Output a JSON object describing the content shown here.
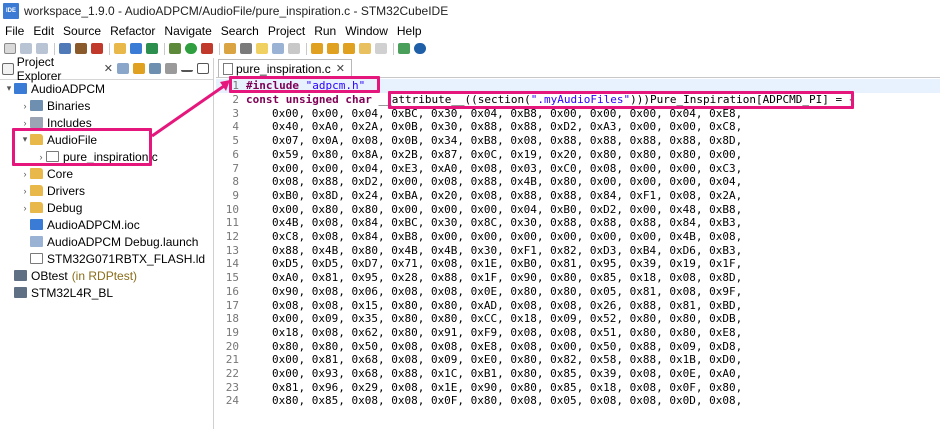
{
  "window": {
    "icon_label": "IDE",
    "title": "workspace_1.9.0 - AudioADPCM/AudioFile/pure_inspiration.c - STM32CubeIDE"
  },
  "menu": [
    "File",
    "Edit",
    "Source",
    "Refactor",
    "Navigate",
    "Search",
    "Project",
    "Run",
    "Window",
    "Help"
  ],
  "explorer": {
    "tab_label": "Project Explorer",
    "close": "✕",
    "tree": [
      {
        "label": "AudioADPCM",
        "twisty": "▾",
        "icon": "project-icon",
        "depth": 0
      },
      {
        "label": "Binaries",
        "twisty": "›",
        "icon": "binaries-icon",
        "depth": 1
      },
      {
        "label": "Includes",
        "twisty": "›",
        "icon": "includes-icon",
        "depth": 1
      },
      {
        "label": "AudioFile",
        "twisty": "▾",
        "icon": "folder-icon",
        "depth": 1
      },
      {
        "label": "pure_inspiration.c",
        "twisty": "›",
        "icon": "c-file-icon",
        "depth": 2
      },
      {
        "label": "Core",
        "twisty": "›",
        "icon": "folder-icon",
        "depth": 1
      },
      {
        "label": "Drivers",
        "twisty": "›",
        "icon": "folder-icon",
        "depth": 1
      },
      {
        "label": "Debug",
        "twisty": "›",
        "icon": "folder-icon",
        "depth": 1
      },
      {
        "label": "AudioADPCM.ioc",
        "twisty": "",
        "icon": "ioc-file-icon",
        "depth": 1
      },
      {
        "label": "AudioADPCM Debug.launch",
        "twisty": "",
        "icon": "launch-file-icon",
        "depth": 1
      },
      {
        "label": "STM32G071RBTX_FLASH.ld",
        "twisty": "",
        "icon": "ld-file-icon",
        "depth": 1
      },
      {
        "label": "OBtest",
        "sub": "(in RDPtest)",
        "twisty": "",
        "icon": "project-icon",
        "depth": 0
      },
      {
        "label": "STM32L4R_BL",
        "twisty": "",
        "icon": "project-icon",
        "depth": 0
      }
    ]
  },
  "editor": {
    "tab_label": "pure_inspiration.c",
    "close": "✕",
    "line1": {
      "kw": "#include",
      "str": "\"adpcm.h\""
    },
    "line2": {
      "kw": "const unsigned char",
      "attr": " __attribute__((section(",
      "section": "\".myAudioFiles\"",
      "rest": ")))Pure_Inspiration[ADPCMD_PI] = {"
    },
    "data_lines": [
      {
        "n": "3",
        "text": "0x00, 0x00, 0x04, 0xBC, 0x30, 0x04, 0xB8, 0x00, 0x00, 0x00, 0x04, 0xE8,"
      },
      {
        "n": "4",
        "text": "0x40, 0xA0, 0x2A, 0x0B, 0x30, 0x88, 0x88, 0xD2, 0xA3, 0x00, 0x00, 0xC8,"
      },
      {
        "n": "5",
        "text": "0x07, 0x0A, 0x08, 0x0B, 0x34, 0xB8, 0x08, 0x88, 0x88, 0x88, 0x88, 0x8D,"
      },
      {
        "n": "6",
        "text": "0x59, 0x80, 0x8A, 0x2B, 0x87, 0x0C, 0x19, 0x20, 0x80, 0x80, 0x80, 0x00,"
      },
      {
        "n": "7",
        "text": "0x00, 0x00, 0x04, 0xE3, 0xA0, 0x08, 0x03, 0xC0, 0x08, 0x00, 0x00, 0xC3,"
      },
      {
        "n": "8",
        "text": "0x08, 0x88, 0xD2, 0x00, 0x08, 0x88, 0x4B, 0x80, 0x00, 0x00, 0x00, 0x04,"
      },
      {
        "n": "9",
        "text": "0xB0, 0x8D, 0x24, 0xBA, 0x20, 0x08, 0x88, 0x88, 0x84, 0xF1, 0x08, 0x2A,"
      },
      {
        "n": "10",
        "text": "0x00, 0x80, 0x80, 0x00, 0x00, 0x00, 0x04, 0xB0, 0xD2, 0x00, 0x48, 0xB8,"
      },
      {
        "n": "11",
        "text": "0x4B, 0x08, 0x84, 0xBC, 0x30, 0x8C, 0x30, 0x88, 0x88, 0x88, 0x84, 0xB3,"
      },
      {
        "n": "12",
        "text": "0xC8, 0x08, 0x84, 0xB8, 0x00, 0x00, 0x00, 0x00, 0x00, 0x00, 0x4B, 0x08,"
      },
      {
        "n": "13",
        "text": "0x88, 0x4B, 0x80, 0x4B, 0x4B, 0x30, 0xF1, 0x82, 0xD3, 0xB4, 0xD6, 0xB3,"
      },
      {
        "n": "14",
        "text": "0xD5, 0xD5, 0xD7, 0x71, 0x08, 0x1E, 0xB0, 0x81, 0x95, 0x39, 0x19, 0x1F,"
      },
      {
        "n": "15",
        "text": "0xA0, 0x81, 0x95, 0x28, 0x88, 0x1F, 0x90, 0x80, 0x85, 0x18, 0x08, 0x8D,"
      },
      {
        "n": "16",
        "text": "0x90, 0x08, 0x06, 0x08, 0x08, 0x0E, 0x80, 0x80, 0x05, 0x81, 0x08, 0x9F,"
      },
      {
        "n": "17",
        "text": "0x08, 0x08, 0x15, 0x80, 0x80, 0xAD, 0x08, 0x08, 0x26, 0x88, 0x81, 0xBD,"
      },
      {
        "n": "18",
        "text": "0x00, 0x09, 0x35, 0x80, 0x80, 0xCC, 0x18, 0x09, 0x52, 0x80, 0x80, 0xDB,"
      },
      {
        "n": "19",
        "text": "0x18, 0x08, 0x62, 0x80, 0x91, 0xF9, 0x08, 0x08, 0x51, 0x80, 0x80, 0xE8,"
      },
      {
        "n": "20",
        "text": "0x80, 0x80, 0x50, 0x08, 0x08, 0xE8, 0x08, 0x00, 0x50, 0x88, 0x09, 0xD8,"
      },
      {
        "n": "21",
        "text": "0x00, 0x81, 0x68, 0x08, 0x09, 0xE0, 0x80, 0x82, 0x58, 0x88, 0x1B, 0xD0,"
      },
      {
        "n": "22",
        "text": "0x00, 0x93, 0x68, 0x88, 0x1C, 0xB1, 0x80, 0x85, 0x39, 0x08, 0x0E, 0xA0,"
      },
      {
        "n": "23",
        "text": "0x81, 0x96, 0x29, 0x08, 0x1E, 0x90, 0x80, 0x85, 0x18, 0x08, 0x0F, 0x80,"
      },
      {
        "n": "24",
        "text": "0x80, 0x85, 0x08, 0x08, 0x0F, 0x80, 0x08, 0x05, 0x08, 0x08, 0x0D, 0x08,"
      }
    ]
  },
  "colors": {
    "highlight": "#e5177d",
    "keyword": "#7f0055",
    "string": "#2a00ff"
  }
}
